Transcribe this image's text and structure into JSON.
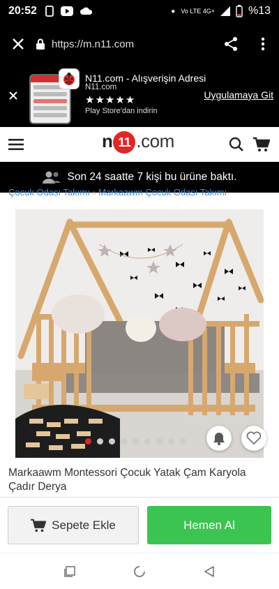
{
  "status_bar": {
    "time": "20:52",
    "network": "Vo LTE 4G+",
    "battery": "%13"
  },
  "browser": {
    "url": "https://m.n11.com"
  },
  "app_banner": {
    "title": "N11.com - Alışverişin Adresi",
    "subtitle": "N11.com",
    "stars": "★★★★★",
    "store_text": "Play Store'dan indirin",
    "cta": "Uygulamaya Git"
  },
  "header": {
    "logo_n": "n",
    "logo_11": "11",
    "logo_dotcom": ".com"
  },
  "notice": {
    "text": "Son 24 saatte 7 kişi bu ürüne baktı."
  },
  "breadcrumb": {
    "item1": "Çocuk Odası Takımı",
    "sep": "›",
    "item2": "Markaawm Çocuk Odası Takımı"
  },
  "product": {
    "title": "Markaawm Montessori Çocuk Yatak Çam Karyola Çadır Derya",
    "image_count": 9,
    "active_image": 1
  },
  "actions": {
    "add_to_cart": "Sepete Ekle",
    "buy_now": "Hemen Al"
  },
  "colors": {
    "brand_red": "#e12626",
    "buy_green": "#3cc451",
    "link_blue": "#3d8dd6"
  }
}
